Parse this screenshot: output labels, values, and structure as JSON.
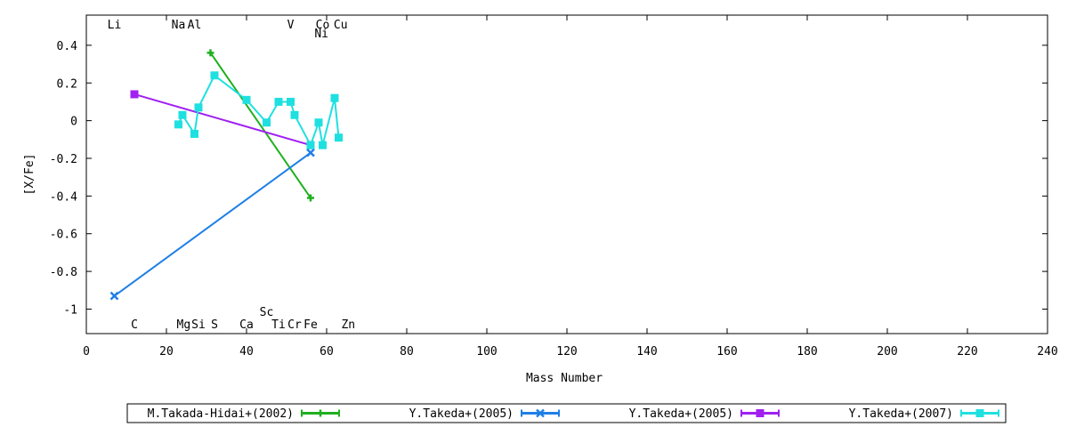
{
  "chart_data": {
    "type": "scatter",
    "title": "",
    "xlabel": "Mass Number",
    "ylabel": "[X/Fe]",
    "xlim": [
      0,
      240
    ],
    "ylim": [
      -1.13,
      0.56
    ],
    "xticks": [
      0,
      20,
      40,
      60,
      80,
      100,
      120,
      140,
      160,
      180,
      200,
      220,
      240
    ],
    "yticks": [
      0.4,
      0.2,
      0,
      -0.2,
      -0.4,
      -0.6,
      -0.8,
      -1
    ],
    "ytick_labels": [
      "0.4",
      "0.2",
      "0",
      "-0.2",
      "-0.4",
      "-0.6",
      "-0.8",
      "-1"
    ],
    "grid": false,
    "legend_position": "bottom",
    "element_labels_top": [
      {
        "text": "Li",
        "mass": 7,
        "row": 0
      },
      {
        "text": "Na",
        "mass": 23,
        "row": 0
      },
      {
        "text": "Al",
        "mass": 27,
        "row": 0
      },
      {
        "text": "V",
        "mass": 51,
        "row": 0
      },
      {
        "text": "Co",
        "mass": 59,
        "row": 0
      },
      {
        "text": "Cu",
        "mass": 63.5,
        "row": 0
      },
      {
        "text": "Ni",
        "mass": 58.7,
        "row": 1
      }
    ],
    "element_labels_bottom": [
      {
        "text": "C",
        "mass": 12,
        "row": 0
      },
      {
        "text": "Mg",
        "mass": 24.3,
        "row": 0
      },
      {
        "text": "Si",
        "mass": 28,
        "row": 0
      },
      {
        "text": "S",
        "mass": 32,
        "row": 0
      },
      {
        "text": "Ca",
        "mass": 40,
        "row": 0
      },
      {
        "text": "Ti",
        "mass": 48,
        "row": 0
      },
      {
        "text": "Cr",
        "mass": 52,
        "row": 0
      },
      {
        "text": "Fe",
        "mass": 56,
        "row": 0
      },
      {
        "text": "Zn",
        "mass": 65.4,
        "row": 0
      },
      {
        "text": "Sc",
        "mass": 45,
        "row": 1
      }
    ],
    "series": [
      {
        "name": "M.Takada-Hidai+(2002)",
        "color": "#1fb01f",
        "marker": "plus",
        "x": [
          31,
          56
        ],
        "y": [
          0.36,
          -0.41
        ]
      },
      {
        "name": "Y.Takeda+(2005)",
        "color": "#1e7fe6",
        "marker": "cross",
        "x": [
          7,
          56
        ],
        "y": [
          -0.93,
          -0.17
        ]
      },
      {
        "name": "Y.Takeda+(2005)",
        "color": "#a020f0",
        "marker": "square",
        "x": [
          12,
          56
        ],
        "y": [
          0.14,
          -0.13
        ]
      },
      {
        "name": "Y.Takeda+(2007)",
        "color": "#1fe0e0",
        "marker": "square",
        "x": [
          23,
          24,
          27,
          28,
          32,
          40,
          45,
          48,
          51,
          52,
          56,
          58,
          59,
          62,
          63
        ],
        "y": [
          -0.02,
          0.03,
          -0.07,
          0.07,
          0.24,
          0.11,
          -0.01,
          0.1,
          0.1,
          0.03,
          -0.13,
          -0.01,
          -0.13,
          0.12,
          -0.09
        ]
      }
    ]
  }
}
